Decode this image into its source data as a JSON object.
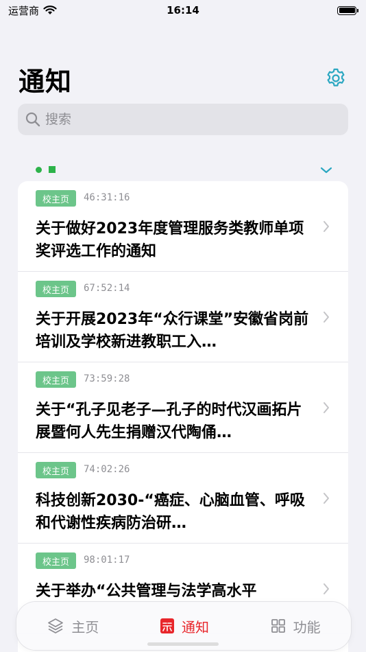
{
  "status_bar": {
    "carrier": "运营商",
    "time": "16:14"
  },
  "header": {
    "title": "通知"
  },
  "search": {
    "placeholder": "搜索"
  },
  "colors": {
    "accent": "#2ba7c1",
    "badge": "#6cc58a",
    "indicator": "#2db34a",
    "active_tab": "#e8262b"
  },
  "items": [
    {
      "tag": "校主页",
      "time": "46:31:16",
      "title": "关于做好2023年度管理服务类教师单项奖评选工作的通知"
    },
    {
      "tag": "校主页",
      "time": "67:52:14",
      "title": "关于开展2023年“众行课堂”安徽省岗前培训及学校新进教职工入…"
    },
    {
      "tag": "校主页",
      "time": "73:59:28",
      "title": "关于“孔子见老子—孔子的时代汉画拓片展暨何人先生捐赠汉代陶俑…"
    },
    {
      "tag": "校主页",
      "time": "74:02:26",
      "title": "科技创新2030-“癌症、心脑血管、呼吸和代谢性疾病防治研…"
    },
    {
      "tag": "校主页",
      "time": "98:01:17",
      "title": "关于举办“公共管理与法学高水平"
    }
  ],
  "tabs": [
    {
      "label": "主页",
      "icon": "layers-icon",
      "active": false
    },
    {
      "label": "通知",
      "icon": "notice-icon",
      "active": true
    },
    {
      "label": "功能",
      "icon": "grid-icon",
      "active": false
    }
  ]
}
